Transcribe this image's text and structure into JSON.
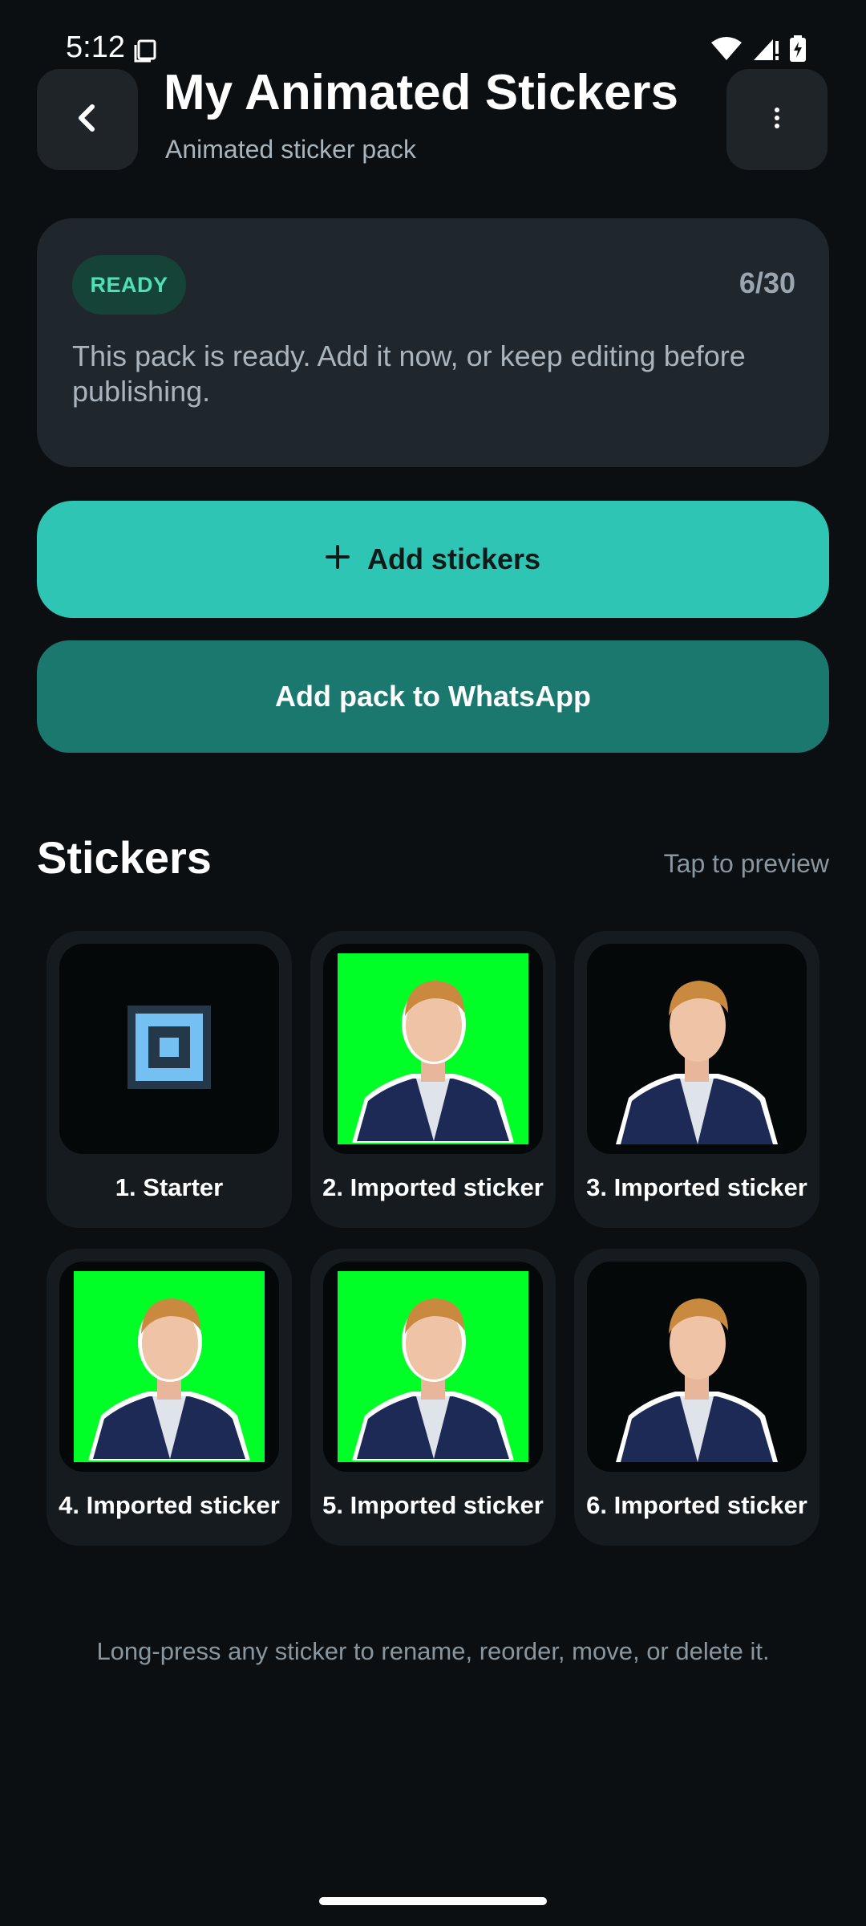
{
  "status_bar": {
    "time": "5:12",
    "icons": [
      "screenshot-icon",
      "wifi-icon",
      "signal-icon",
      "battery-charging-icon"
    ]
  },
  "header": {
    "title": "My Animated Stickers",
    "subtitle": "Animated sticker pack",
    "back_icon": "chevron-left-icon",
    "more_icon": "more-vertical-icon"
  },
  "status_card": {
    "badge": "READY",
    "count": "6/30",
    "message": "This pack is ready. Add it now, or keep editing before publishing."
  },
  "actions": {
    "add_stickers_label": "Add stickers",
    "add_stickers_icon": "plus-icon",
    "add_to_whatsapp_label": "Add pack to WhatsApp"
  },
  "stickers_section": {
    "title": "Stickers",
    "hint": "Tap to preview",
    "items": [
      {
        "label": "1. Starter",
        "thumbnail": "starter-square-icon"
      },
      {
        "label": "2. Imported sticker",
        "thumbnail": "portrait-green-background"
      },
      {
        "label": "3. Imported sticker",
        "thumbnail": "portrait-transparent"
      },
      {
        "label": "4. Imported sticker",
        "thumbnail": "portrait-green-background"
      },
      {
        "label": "5. Imported sticker",
        "thumbnail": "portrait-green-background"
      },
      {
        "label": "6. Imported sticker",
        "thumbnail": "portrait-transparent"
      }
    ]
  },
  "footer_hint": "Long-press any sticker to rename, reorder, move, or delete it.",
  "colors": {
    "background": "#0b0f12",
    "card": "#20272c",
    "accent": "#2ec5b4",
    "whatsapp_button": "#1a786f",
    "ready_badge_bg": "#164337",
    "ready_badge_text": "#4fe0b6",
    "sticker_green": "#00ff26"
  }
}
